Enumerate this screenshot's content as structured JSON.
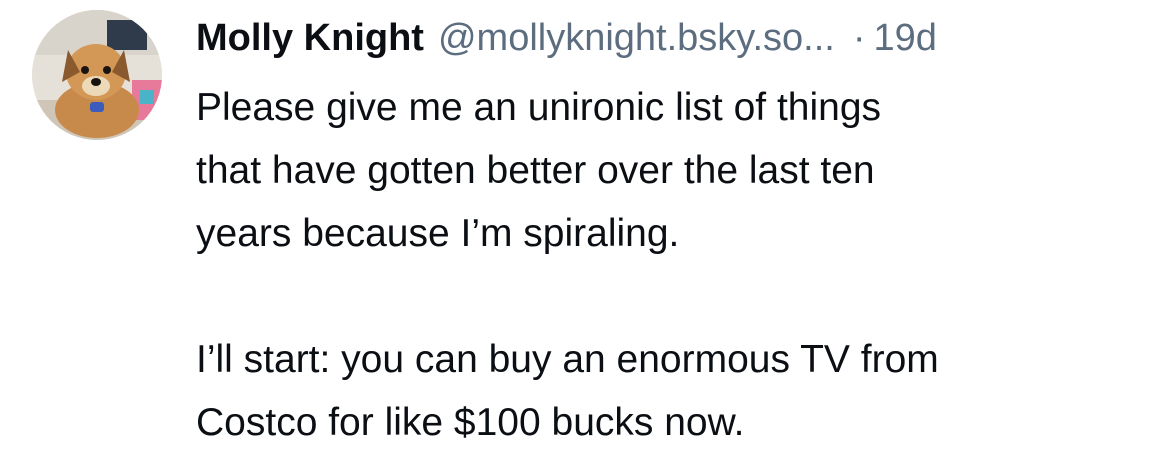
{
  "post": {
    "author": {
      "display_name": "Molly Knight",
      "handle": "@mollyknight.bsky.so...",
      "avatar_icon": "dog-avatar"
    },
    "separator": "·",
    "timestamp": "19d",
    "paragraphs": [
      {
        "lines": [
          "Please give me an unironic list of things",
          "that have gotten better over the last ten",
          "years because I’m spiraling."
        ]
      },
      {
        "lines": [
          "I’ll start: you can buy an enormous TV from",
          "Costco for like $100 bucks now."
        ]
      }
    ]
  }
}
